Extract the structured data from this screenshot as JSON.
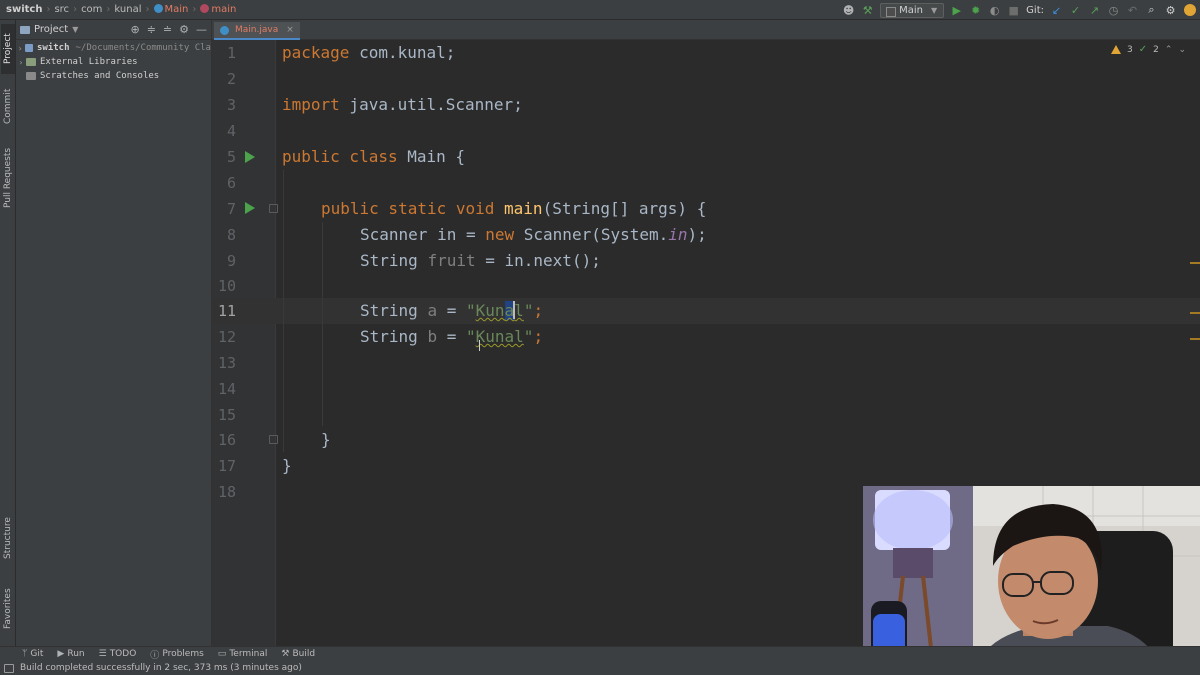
{
  "breadcrumb": {
    "items": [
      "switch",
      "src",
      "com",
      "kunal"
    ],
    "class_name": "Main",
    "method_name": "main"
  },
  "toolbar": {
    "run_config": "Main",
    "git_label": "Git:",
    "icons": [
      "user-icon",
      "build-hammer-icon",
      "run-icon",
      "debug-icon",
      "coverage-icon",
      "stop-icon",
      "git-update-icon",
      "git-commit-icon",
      "git-push-icon",
      "history-icon",
      "rollback-icon",
      "search-icon",
      "settings-icon",
      "update-icon"
    ]
  },
  "left_strip": {
    "tabs": [
      "Project",
      "Commit",
      "Pull Requests",
      "Structure",
      "Favorites"
    ]
  },
  "project_panel": {
    "title": "Project",
    "tree": [
      {
        "label": "switch",
        "path": "~/Documents/Community Cla",
        "expanded": false
      },
      {
        "label": "External Libraries"
      },
      {
        "label": "Scratches and Consoles"
      }
    ]
  },
  "editor": {
    "tab_label": "Main.java",
    "inspections": {
      "warnings": "3",
      "weak_warnings": "2"
    },
    "line_numbers": [
      "1",
      "2",
      "3",
      "4",
      "5",
      "6",
      "7",
      "8",
      "9",
      "10",
      "11",
      "12",
      "13",
      "14",
      "15",
      "16",
      "17",
      "18"
    ],
    "current_line": "11",
    "code": {
      "l1_kw": "package",
      "l1_rest": " com.kunal;",
      "l3_kw": "import",
      "l3_rest": " java.util.Scanner;",
      "l5_kw": "public class",
      "l5_rest": " Main {",
      "l7_kw": "public static void",
      "l7_fn": "main",
      "l7_rest": "(String[] args) {",
      "l8_a": "Scanner in = ",
      "l8_kw": "new",
      "l8_b": " Scanner(System.",
      "l8_static": "in",
      "l8_c": ");",
      "l9_a": "String ",
      "l9_var": "fruit",
      "l9_b": " = in.next();",
      "l11_a": "String ",
      "l11_var": "a",
      "l11_b": " = ",
      "l11_q1": "\"",
      "l11_s1": "Kun",
      "l11_sel": "a",
      "l11_s2": "l",
      "l11_q2": "\"",
      "l11_c": ";",
      "l12_a": "String ",
      "l12_var": "b",
      "l12_b": " = ",
      "l12_q1": "\"",
      "l12_s": "Kunal",
      "l12_q2": "\"",
      "l12_c": ";",
      "l16": "}",
      "l17": "}"
    }
  },
  "bottom_tabs": [
    "Git",
    "Run",
    "TODO",
    "Problems",
    "Terminal",
    "Build"
  ],
  "status": "Build completed successfully in 2 sec, 373 ms (3 minutes ago)",
  "colors": {
    "keyword": "#cc7832",
    "method": "#ffc66d",
    "string": "#6a8759",
    "text": "#a9b7c6",
    "run_green": "#4ca34b"
  }
}
